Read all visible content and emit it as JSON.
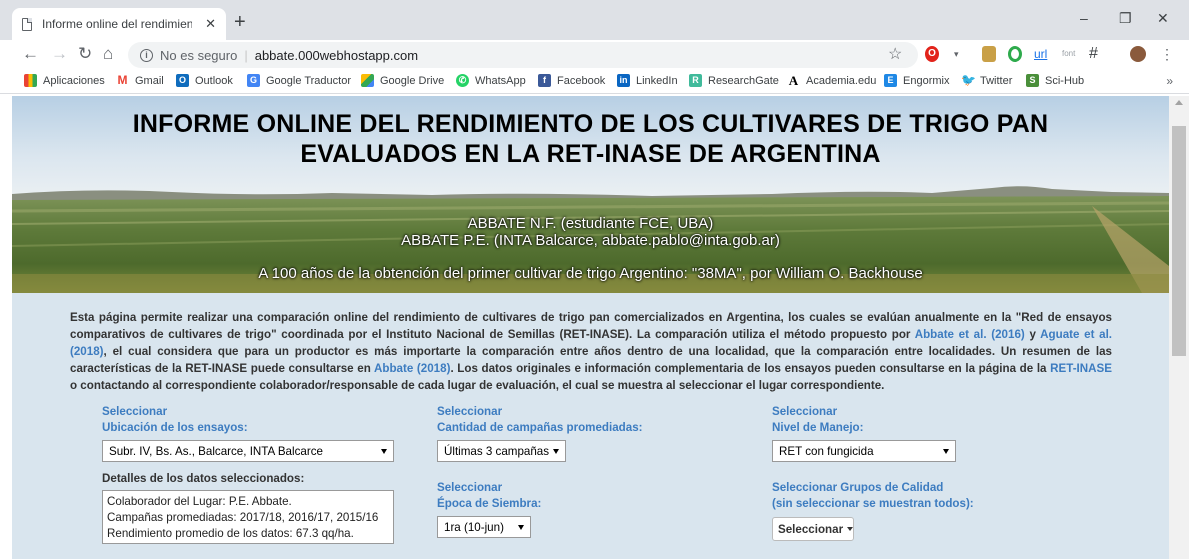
{
  "browser": {
    "tab_title": "Informe online del rendimiento d",
    "tab_close": "✕",
    "new_tab": "+",
    "window_controls": {
      "minimize": "–",
      "restore": "❐",
      "close": "✕"
    },
    "security_text": "No es seguro",
    "url": "abbate.000webhostapp.com",
    "bookmarks": [
      {
        "label": "Aplicaciones",
        "icon": "apps-icon",
        "color": "#e94235"
      },
      {
        "label": "Gmail",
        "icon": "gmail-icon",
        "color": "#ea4335"
      },
      {
        "label": "Outlook",
        "icon": "outlook-icon",
        "color": "#0f6cbd"
      },
      {
        "label": "Google Traductor",
        "icon": "translate-icon",
        "color": "#4285f4"
      },
      {
        "label": "Google Drive",
        "icon": "drive-icon",
        "color": "#fbbc04"
      },
      {
        "label": "WhatsApp",
        "icon": "whatsapp-icon",
        "color": "#25d366"
      },
      {
        "label": "Facebook",
        "icon": "facebook-icon",
        "color": "#3b5998"
      },
      {
        "label": "LinkedIn",
        "icon": "linkedin-icon",
        "color": "#0a66c2"
      },
      {
        "label": "ResearchGate",
        "icon": "researchgate-icon",
        "color": "#40ba9b"
      },
      {
        "label": "Academia.edu",
        "icon": "academia-icon",
        "color": "#000000"
      },
      {
        "label": "Engormix",
        "icon": "engormix-icon",
        "color": "#1e88e5"
      },
      {
        "label": "Twitter",
        "icon": "twitter-icon",
        "color": "#1da1f2"
      },
      {
        "label": "Sci-Hub",
        "icon": "scihub-icon",
        "color": "#4a8f3a"
      }
    ],
    "bookmarks_more": "»"
  },
  "banner": {
    "title_line1": "INFORME ONLINE DEL RENDIMIENTO DE LOS CULTIVARES DE TRIGO PAN",
    "title_line2": "EVALUADOS EN LA RET-INASE DE ARGENTINA",
    "author1": "ABBATE N.F. (estudiante FCE, UBA)",
    "author2": "ABBATE P.E. (INTA Balcarce, abbate.pablo@inta.gob.ar)",
    "tagline": "A 100 años de la obtención del primer cultivar de trigo Argentino: \"38MA\", por William O. Backhouse"
  },
  "intro": {
    "p1": "Esta página permite realizar una comparación online del rendimiento de cultivares de trigo pan comercializados en Argentina, los cuales se evalúan anualmente en la \"Red de ensayos comparativos de cultivares de trigo\" coordinada por el Instituto Nacional de Semillas (RET-INASE). La comparación utiliza el método propuesto por ",
    "link1": "Abbate et al. (2016)",
    "p2": " y ",
    "link2": "Aguate et al. (2018)",
    "p3": ", el cual considera que para un productor es más importarte la comparación entre años dentro de una localidad, que la comparación entre localidades. Un resumen de las características de la RET-INASE puede consultarse en ",
    "link3": "Abbate (2018)",
    "p4": ". Los datos originales e información complementaria de los ensayos pueden consultarse en la página de la ",
    "link4": "RET-INASE",
    "p5": " o contactando al correspondiente colaborador/responsable de cada lugar de evaluación, el cual se muestra al seleccionar el lugar correspondiente."
  },
  "controls": {
    "ubicacion": {
      "label1": "Seleccionar",
      "label2": "Ubicación de los ensayos:",
      "value": "Subr. IV, Bs. As., Balcarce, INTA Balcarce"
    },
    "campanias": {
      "label1": "Seleccionar",
      "label2": "Cantidad de campañas promediadas:",
      "value": "Últimas 3 campañas"
    },
    "manejo": {
      "label1": "Seleccionar",
      "label2": "Nivel de Manejo:",
      "value": "RET con fungicida"
    },
    "epoca": {
      "label1": "Seleccionar",
      "label2": "Época de Siembra:",
      "value": "1ra (10-jun)"
    },
    "grupos": {
      "label1": "Seleccionar Grupos de Calidad",
      "label2": "(sin seleccionar se muestran todos):",
      "button": "Seleccionar"
    },
    "details": {
      "label": "Detalles de los datos seleccionados:",
      "line1": "Colaborador del Lugar: P.E. Abbate.",
      "line2": "Campañas promediadas: 2017/18, 2016/17, 2015/16",
      "line3": "Rendimiento promedio de los datos: 67.3 qq/ha."
    }
  }
}
